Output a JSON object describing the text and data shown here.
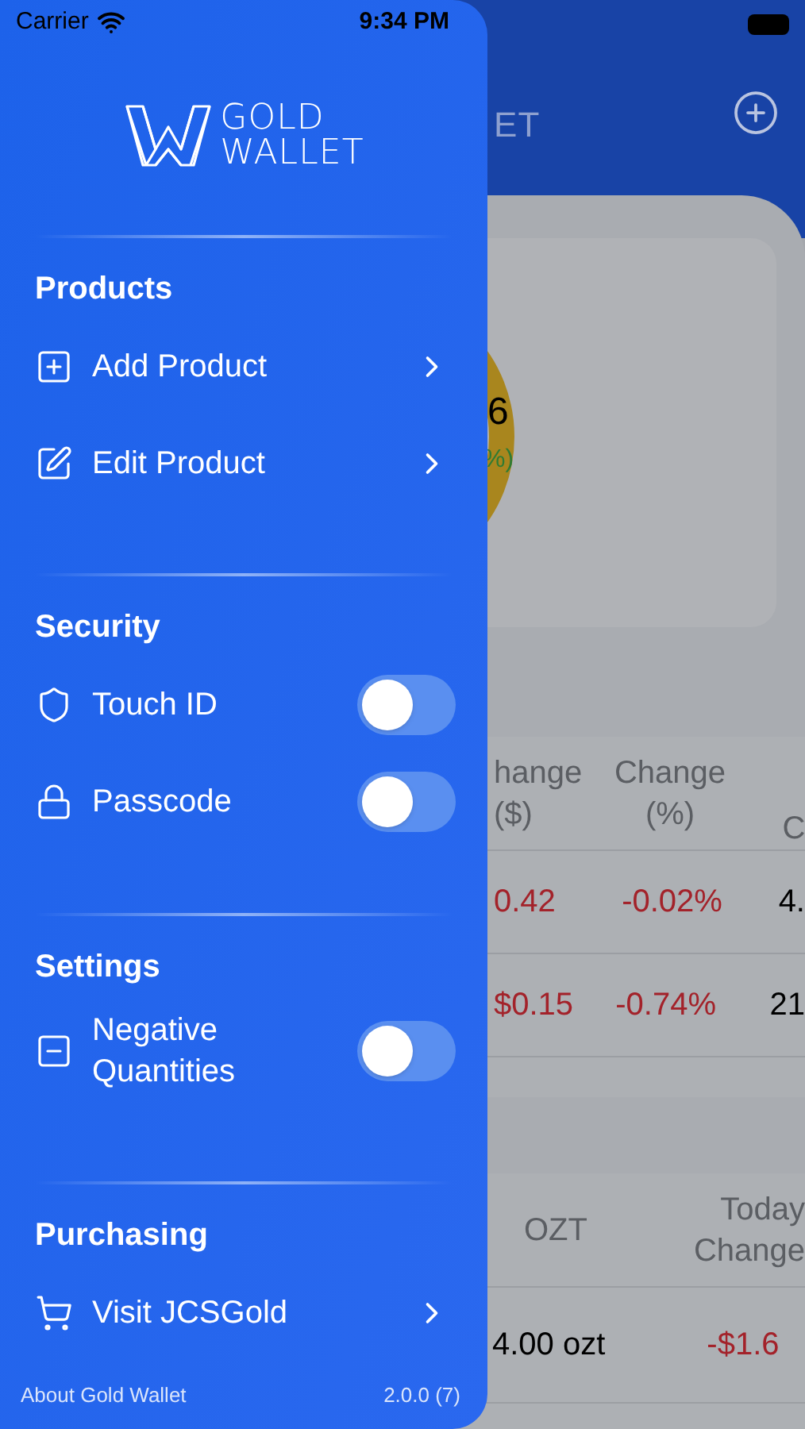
{
  "status_bar": {
    "carrier": "Carrier",
    "time": "9:34 PM"
  },
  "drawer": {
    "logo": {
      "line1": "GOLD",
      "line2": "WALLET"
    },
    "sections": [
      {
        "title": "Products",
        "items": [
          {
            "kind": "link",
            "label": "Add Product"
          },
          {
            "kind": "link",
            "label": "Edit Product"
          }
        ]
      },
      {
        "title": "Security",
        "items": [
          {
            "kind": "toggle",
            "label": "Touch ID",
            "on": false
          },
          {
            "kind": "toggle",
            "label": "Passcode",
            "on": false
          }
        ]
      },
      {
        "title": "Settings",
        "items": [
          {
            "kind": "toggle",
            "label": "Negative Quantities",
            "on": false
          }
        ]
      },
      {
        "title": "Purchasing",
        "items": [
          {
            "kind": "link",
            "label": "Visit JCSGold"
          }
        ]
      }
    ],
    "footer": {
      "about": "About Gold Wallet",
      "version": "2.0.0 (7)"
    }
  },
  "background": {
    "header_title": "ET",
    "summary": {
      "value": "6",
      "change": "%)"
    },
    "holdings_table": {
      "headers": [
        [
          "hange",
          "($)"
        ],
        [
          "Change",
          "(%)"
        ],
        [
          "C"
        ]
      ],
      "rows": [
        [
          "0.42",
          "-0.02%",
          "4."
        ],
        [
          "$0.15",
          "-0.74%",
          "21"
        ]
      ]
    },
    "positions_table": {
      "headers": [
        "OZT",
        "Today Change"
      ],
      "rows": [
        [
          "4.00 ozt",
          "-$1.6"
        ]
      ]
    }
  }
}
